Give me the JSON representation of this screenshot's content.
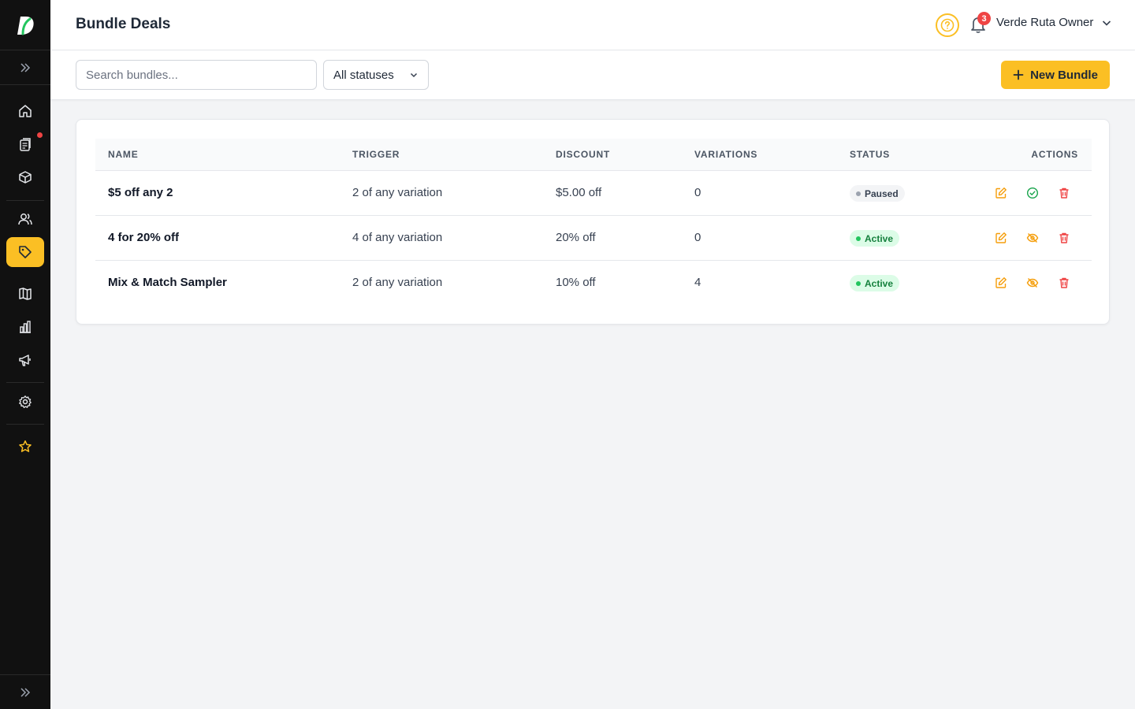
{
  "app": {
    "logo_letter": "D",
    "accent_color": "#fbbf24"
  },
  "sidebar": {
    "items": [
      {
        "name": "home-icon",
        "active": false
      },
      {
        "name": "orders-icon",
        "active": false,
        "dot": true
      },
      {
        "name": "products-box-icon",
        "active": false
      },
      {
        "name": "customers-icon",
        "active": false
      },
      {
        "name": "tag-icon",
        "active": true
      },
      {
        "name": "catalog-book-icon",
        "active": false
      },
      {
        "name": "analytics-bar-icon",
        "active": false
      },
      {
        "name": "megaphone-icon",
        "active": false
      },
      {
        "name": "gear-icon",
        "active": false
      },
      {
        "name": "star-icon",
        "active": false
      }
    ]
  },
  "header": {
    "title": "Bundle Deals",
    "notification_count": "3",
    "user_name": "Verde Ruta Owner"
  },
  "toolbar": {
    "search_placeholder": "Search bundles...",
    "status_filter": "All statuses",
    "new_button_label": "New Bundle"
  },
  "table": {
    "columns": {
      "name": "NAME",
      "trigger": "TRIGGER",
      "discount": "DISCOUNT",
      "variations": "VARIATIONS",
      "status": "STATUS",
      "actions": "ACTIONS"
    },
    "rows": [
      {
        "name": "$5 off any 2",
        "trigger": "2 of any variation",
        "discount": "$5.00 off",
        "variations": "0",
        "status": "Paused",
        "toggle_icon": "activate-check-icon"
      },
      {
        "name": "4 for 20% off",
        "trigger": "4 of any variation",
        "discount": "20% off",
        "variations": "0",
        "status": "Active",
        "toggle_icon": "pause-eye-off-icon"
      },
      {
        "name": "Mix & Match Sampler",
        "trigger": "2 of any variation",
        "discount": "10% off",
        "variations": "4",
        "status": "Active",
        "toggle_icon": "pause-eye-off-icon"
      }
    ]
  }
}
